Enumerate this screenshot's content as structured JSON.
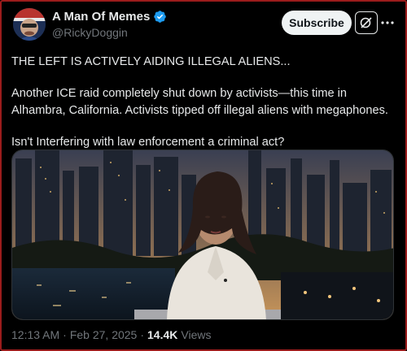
{
  "author": {
    "display_name": "A Man Of Memes",
    "handle": "@RickyDoggin",
    "verified": true
  },
  "actions": {
    "subscribe_label": "Subscribe",
    "grok_icon": "grok-icon",
    "more_icon": "more-horizontal-icon"
  },
  "tweet": {
    "line1": "THE LEFT IS ACTIVELY AIDING ILLEGAL ALIENS...",
    "para2_line1": "Another ICE raid completely shut down by activists—this time in",
    "para2_line2": "Alhambra, California. Activists tipped off illegal aliens with megaphones.",
    "line3": "Isn't Interfering with law enforcement a criminal act?"
  },
  "media": {
    "type": "video-thumbnail",
    "description_icon": "news-anchor-video"
  },
  "meta": {
    "time": "12:13 AM",
    "separator": "·",
    "date": "Feb 27, 2025",
    "views_count": "14.4K",
    "views_label": "Views"
  },
  "colors": {
    "background": "#000000",
    "text_primary": "#e7e9ea",
    "text_secondary": "#71767b",
    "verified_blue": "#1d9bf0",
    "frame_border": "#9b1c1c"
  }
}
